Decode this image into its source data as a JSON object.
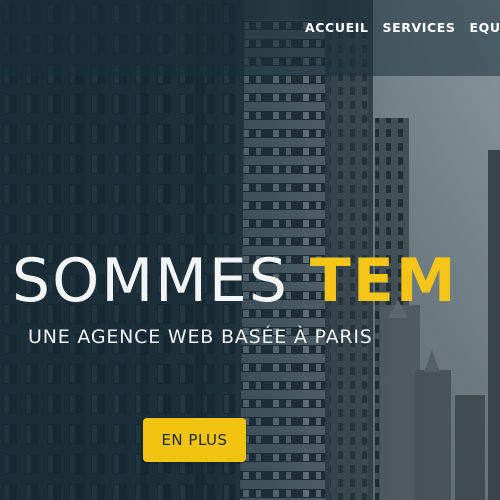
{
  "nav": {
    "items": [
      {
        "label": "ACCUEIL"
      },
      {
        "label": "SERVICES"
      },
      {
        "label": "EQUIPE"
      }
    ]
  },
  "hero": {
    "headline_main": "SOMMES ",
    "headline_accent": "TEM",
    "subheadline": "UNE AGENCE WEB BASÉE À PARIS",
    "cta_label": "EN PLUS"
  },
  "colors": {
    "accent": "#f5c518",
    "overlay": "#1a3040",
    "text": "#ffffff"
  }
}
